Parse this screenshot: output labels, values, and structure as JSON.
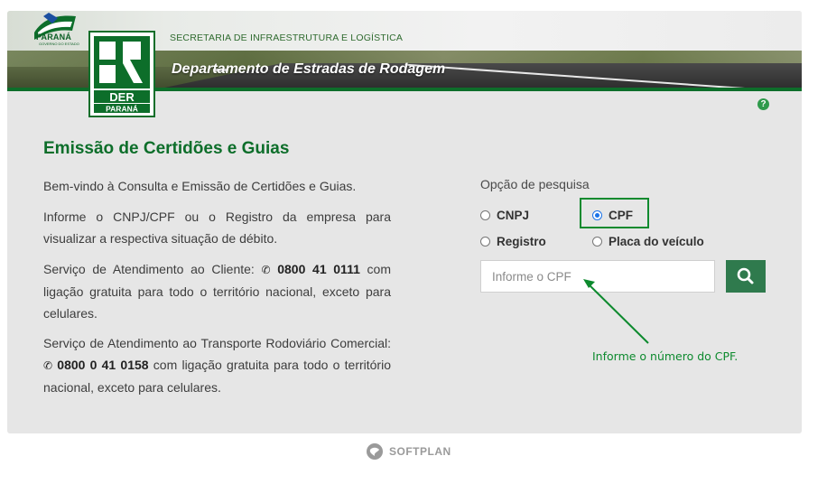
{
  "header": {
    "state_name": "PARANÁ",
    "state_subtitle": "GOVERNO DO ESTADO",
    "der_logo_top": "DER",
    "der_logo_bottom": "PARANÁ",
    "secretaria": "SECRETARIA DE INFRAESTRUTURA E LOGÍSTICA",
    "department": "Departamento de Estradas de Rodagem"
  },
  "main": {
    "title": "Emissão de Certidões e Guias",
    "welcome": "Bem-vindo à Consulta e Emissão de Certidões e Guias.",
    "instructions": "Informe o CNPJ/CPF ou o Registro da empresa para visualizar a respectiva situação de débito.",
    "customer_service": {
      "prefix": "Serviço de Atendimento ao Cliente:",
      "phone": "0800 41 0111",
      "suffix": "com ligação gratuita para todo o território nacional, exceto para celulares."
    },
    "transport_service": {
      "prefix": "Serviço de Atendimento ao Transporte Rodoviário Comercial:",
      "phone": "0800 0 41 0158",
      "suffix": "com ligação gratuita para todo o território nacional, exceto para celulares."
    }
  },
  "search": {
    "label": "Opção de pesquisa",
    "options": [
      {
        "label": "CNPJ",
        "checked": false
      },
      {
        "label": "CPF",
        "checked": true
      },
      {
        "label": "Registro",
        "checked": false
      },
      {
        "label": "Placa do veículo",
        "checked": false
      }
    ],
    "placeholder": "Informe o CPF",
    "value": ""
  },
  "annotation": "Informe o número do CPF.",
  "footer": {
    "brand": "SOFTPLAN"
  },
  "colors": {
    "brand_green": "#0d6e2a",
    "button_green": "#2f7a4d",
    "annotation_green": "#0d8a2e",
    "radio_blue": "#1a73e8"
  }
}
